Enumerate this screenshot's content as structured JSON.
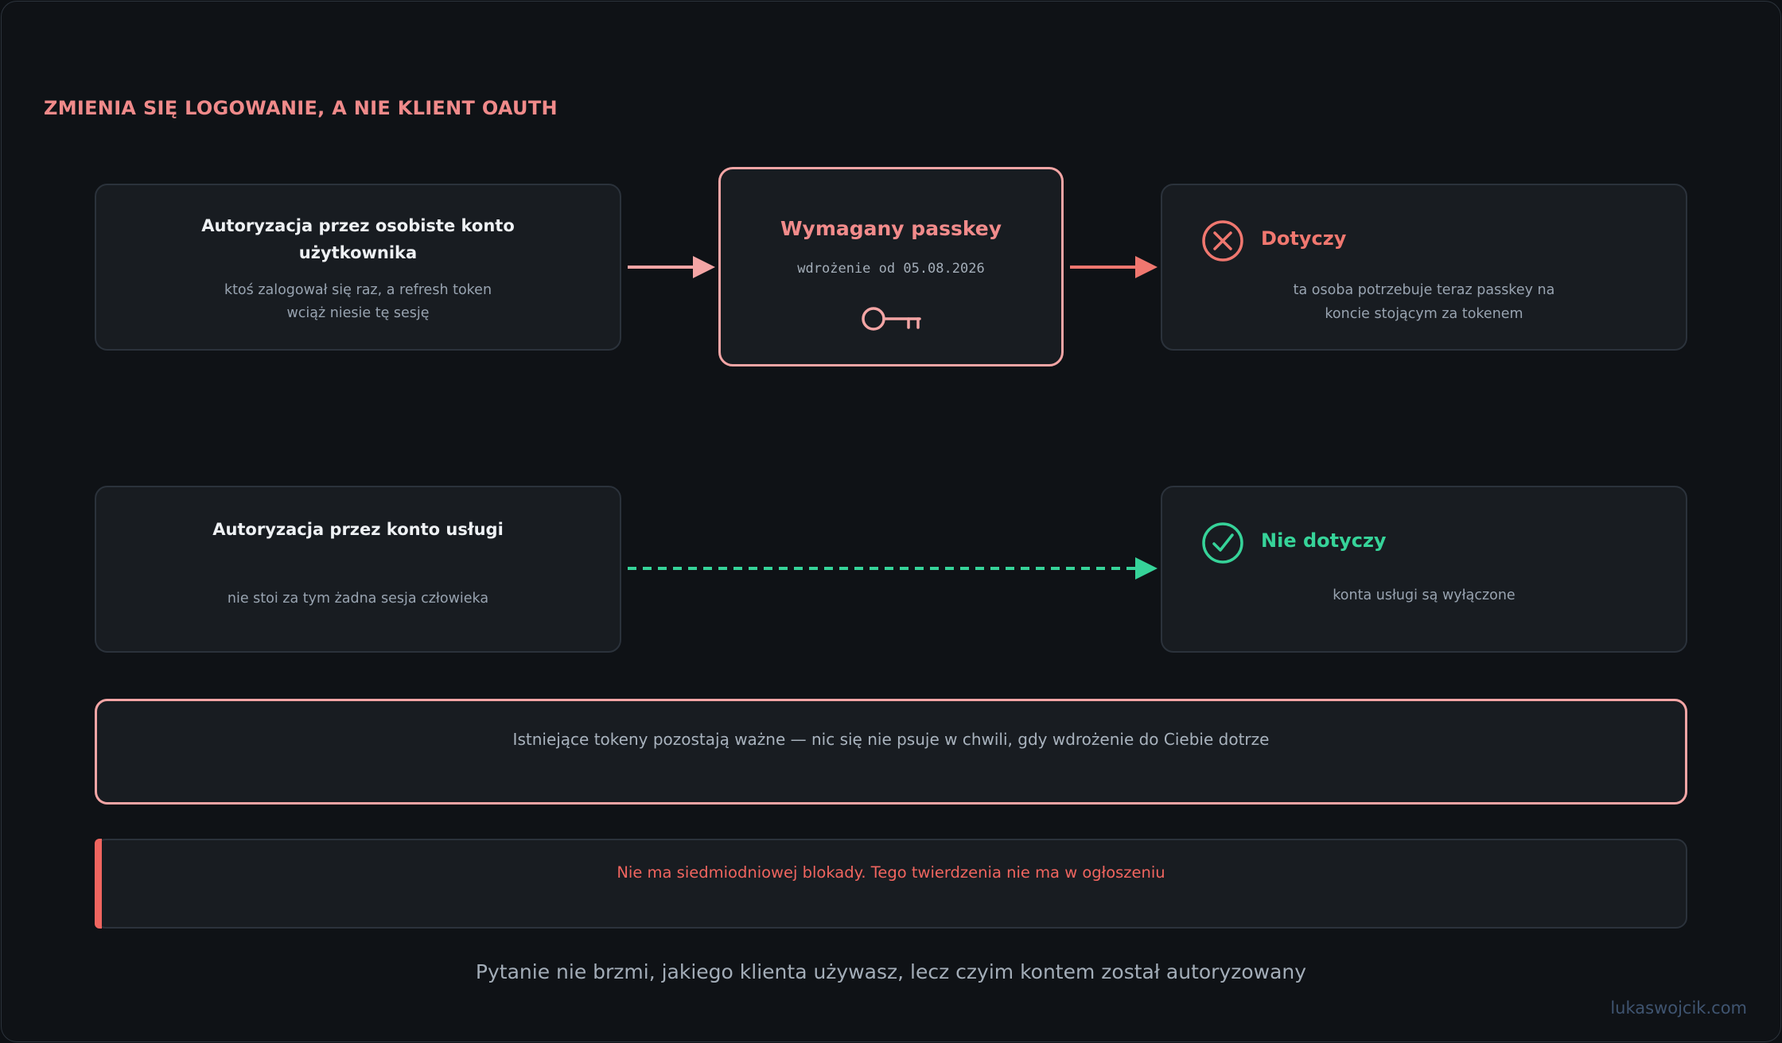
{
  "title": "ZMIENIA SIĘ LOGOWANIE, A NIE KLIENT OAUTH",
  "user_account": {
    "title_line1": "Autoryzacja przez osobiste konto",
    "title_line2": "użytkownika",
    "sub_line1": "ktoś zalogował się raz, a refresh token",
    "sub_line2": "wciąż niesie tę sesję"
  },
  "passkey": {
    "title": "Wymagany passkey",
    "rollout": "wdrożenie od 05.08.2026",
    "icon": "key-icon"
  },
  "affected": {
    "title": "Dotyczy",
    "sub_line1": "ta osoba potrzebuje teraz passkey na",
    "sub_line2": "koncie stojącym za tokenem",
    "icon": "x-circle-icon",
    "color": "#f0776f"
  },
  "service_account": {
    "title": "Autoryzacja przez konto usługi",
    "sub": "nie stoi za tym żadna sesja człowieka"
  },
  "not_affected": {
    "title": "Nie dotyczy",
    "sub": "konta usługi są wyłączone",
    "icon": "check-circle-icon",
    "color": "#36d399"
  },
  "banner": "Istniejące tokeny pozostają ważne — nic się nie psuje w chwili, gdy wdrożenie do Ciebie dotrze",
  "warning": "Nie ma siedmiodniowej blokady. Tego twierdzenia nie ma w ogłoszeniu",
  "footer_question": "Pytanie nie brzmi, jakiego klienta używasz, lecz czyim kontem został autoryzowany",
  "credit": "lukaswojcik.com",
  "colors": {
    "accent_pink": "#f4a5a5",
    "accent_red": "#f0655f",
    "accent_green": "#36d399"
  }
}
